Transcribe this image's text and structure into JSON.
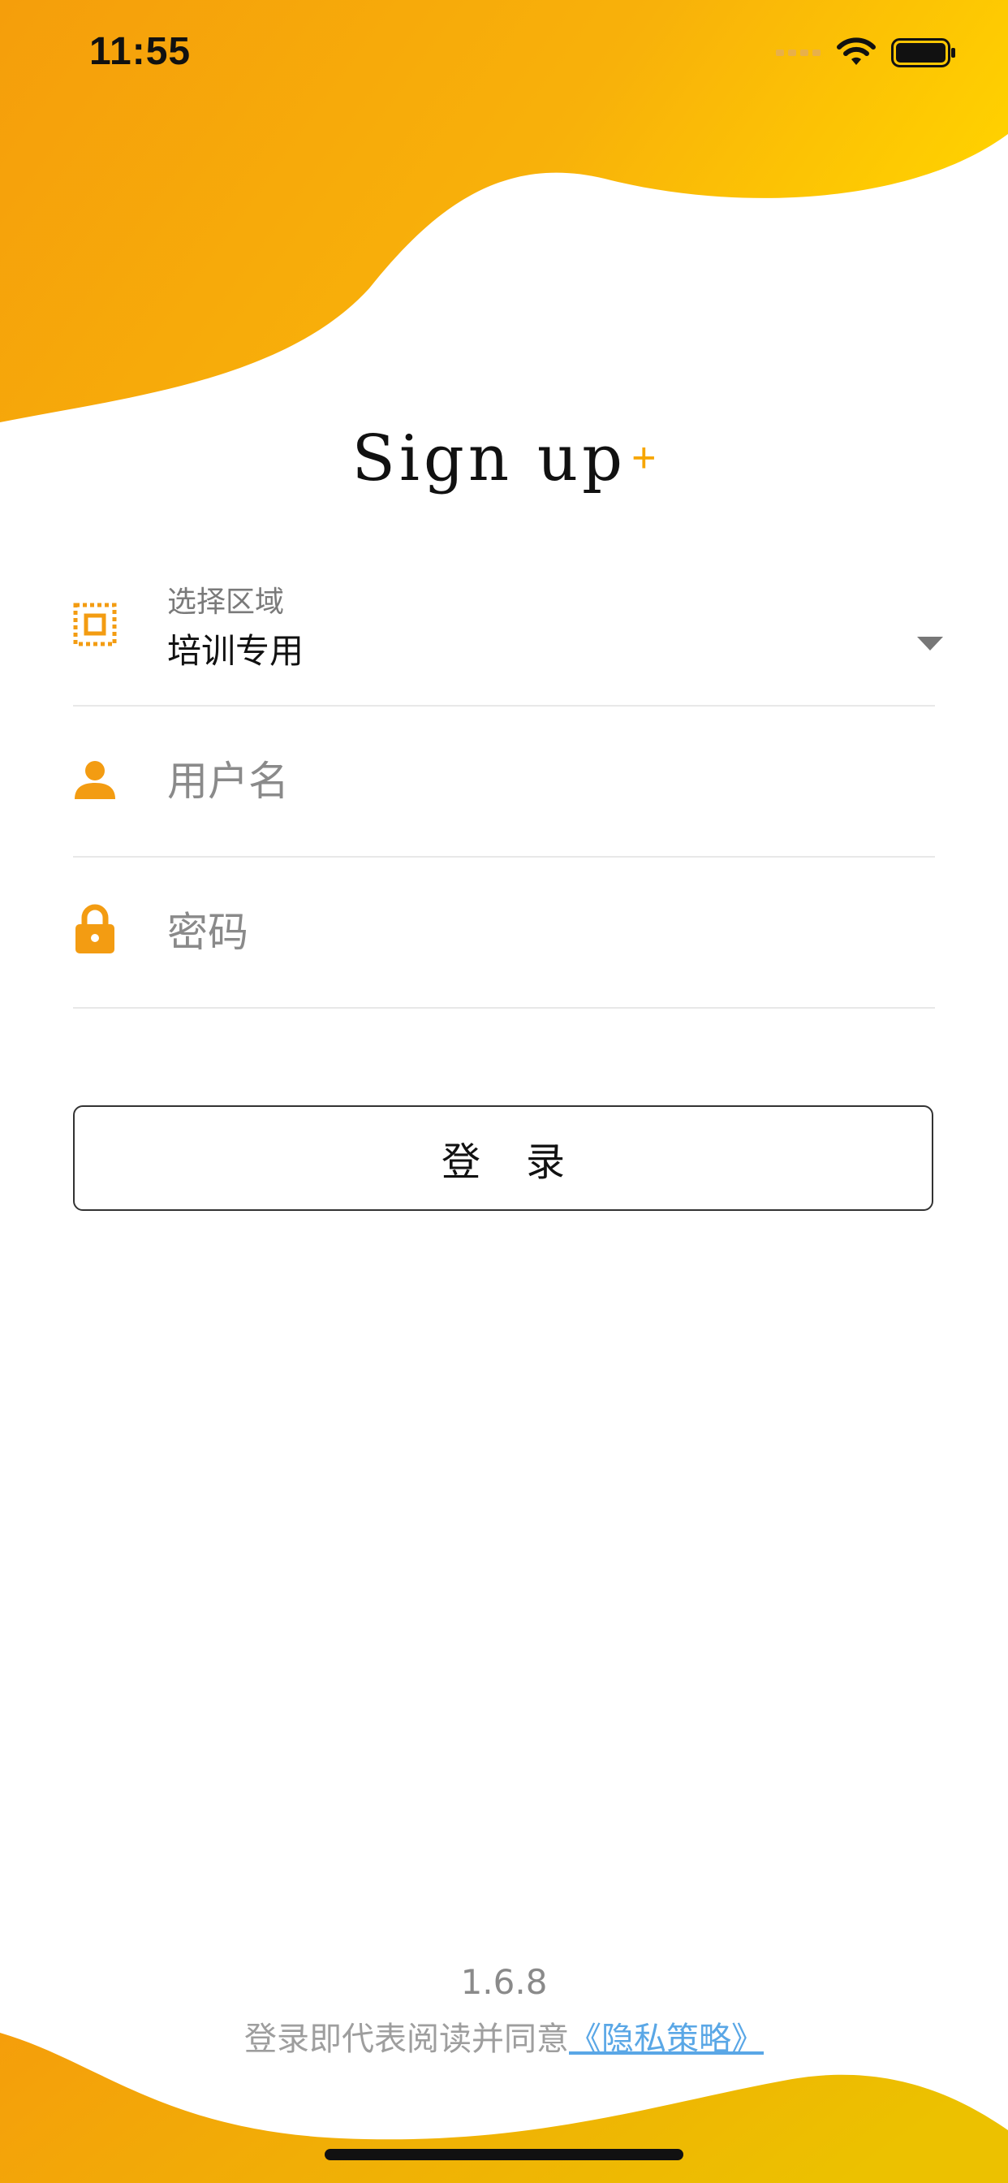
{
  "status_bar": {
    "time": "11:55",
    "icons": [
      "signal-icon",
      "wifi-icon",
      "battery-icon"
    ]
  },
  "title": {
    "text": "Sign up",
    "plus": "+"
  },
  "form": {
    "region_label": "选择区域",
    "region_value": "培训专用",
    "username_placeholder": "用户名",
    "username_value": "",
    "password_placeholder": "密码",
    "password_value": ""
  },
  "login_button": {
    "label": "登录"
  },
  "footer": {
    "version": "1.6.8",
    "agreement_prefix": "登录即代表阅读并同意",
    "privacy_link": "《隐私策略》"
  },
  "colors": {
    "accent_orange": "#f7a600",
    "icon_orange": "#f39c12",
    "link_blue": "#5aa7e6",
    "wave_start": "#f5a10f",
    "wave_end": "#ffcf00"
  }
}
